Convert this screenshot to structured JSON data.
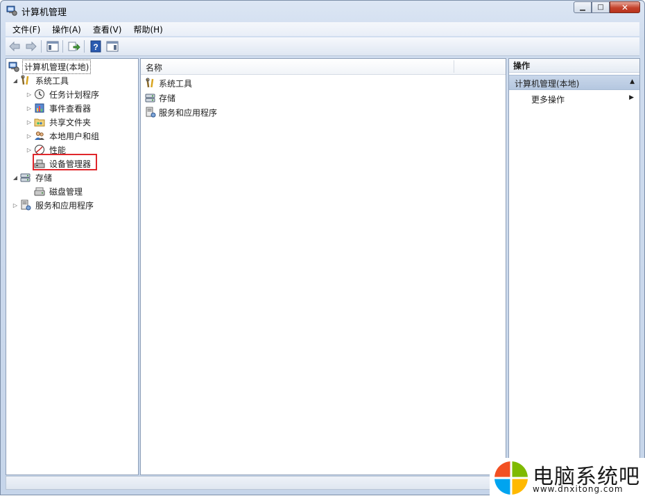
{
  "window": {
    "title": "计算机管理"
  },
  "menubar": {
    "items": [
      "文件(F)",
      "操作(A)",
      "查看(V)",
      "帮助(H)"
    ]
  },
  "tree": {
    "root": "计算机管理(本地)",
    "system_tools": "系统工具",
    "task_scheduler": "任务计划程序",
    "event_viewer": "事件查看器",
    "shared_folders": "共享文件夹",
    "local_users": "本地用户和组",
    "performance": "性能",
    "device_manager": "设备管理器",
    "storage": "存储",
    "disk_management": "磁盘管理",
    "services_apps": "服务和应用程序"
  },
  "list": {
    "column_name": "名称",
    "items": [
      "系统工具",
      "存储",
      "服务和应用程序"
    ]
  },
  "actions": {
    "header": "操作",
    "section": "计算机管理(本地)",
    "more": "更多操作"
  },
  "watermark": {
    "title": "电脑系统吧",
    "url": "www.dnxitong.com"
  }
}
